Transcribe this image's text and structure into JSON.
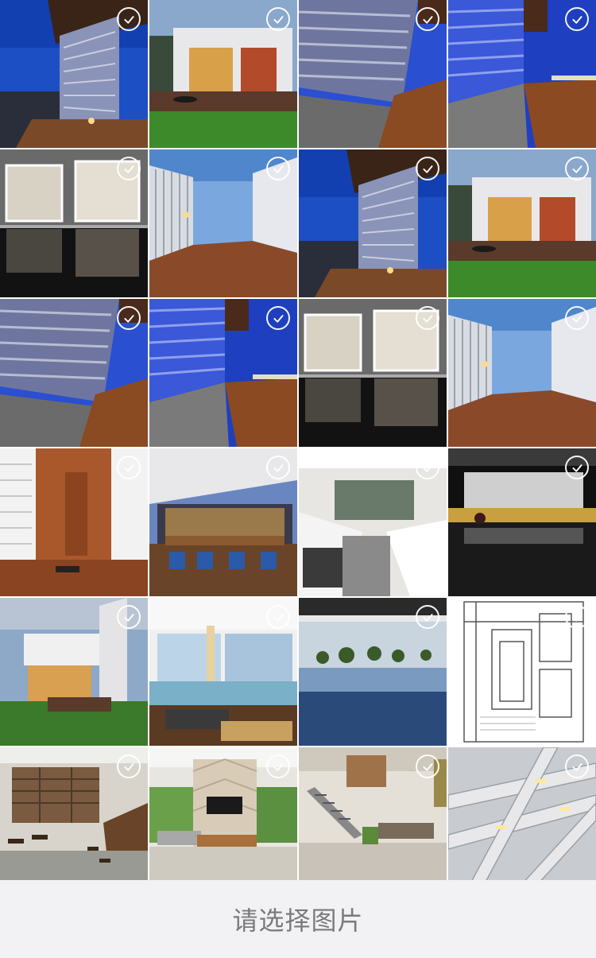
{
  "photo_grid": {
    "tiles": [
      {
        "subject": "dusk-facade-slats"
      },
      {
        "subject": "house-courtyard-lawn"
      },
      {
        "subject": "slatted-wall-pebbles"
      },
      {
        "subject": "slatted-wall-walkway"
      },
      {
        "subject": "glass-doors-reflection"
      },
      {
        "subject": "white-fence-deck"
      },
      {
        "subject": "dusk-facade-slats"
      },
      {
        "subject": "house-courtyard-lawn"
      },
      {
        "subject": "slatted-wall-pebbles"
      },
      {
        "subject": "slatted-wall-walkway"
      },
      {
        "subject": "glass-doors-reflection"
      },
      {
        "subject": "white-fence-deck"
      },
      {
        "subject": "wood-door-entrance"
      },
      {
        "subject": "dining-terrace"
      },
      {
        "subject": "white-kitchen"
      },
      {
        "subject": "reflecting-pool-night"
      },
      {
        "subject": "villa-exterior-lawn"
      },
      {
        "subject": "covered-patio-pool"
      },
      {
        "subject": "infinity-pool-trees"
      },
      {
        "subject": "floor-plan-drawing"
      },
      {
        "subject": "wine-bar-interior"
      },
      {
        "subject": "fireplace-living-room"
      },
      {
        "subject": "loft-staircase"
      },
      {
        "subject": "canopy-beams"
      }
    ]
  },
  "footer": {
    "label": "请选择图片"
  },
  "colors": {
    "footer_bg": "#f2f2f4",
    "footer_text": "#7a7a7c",
    "check_border": "#ffffff"
  }
}
